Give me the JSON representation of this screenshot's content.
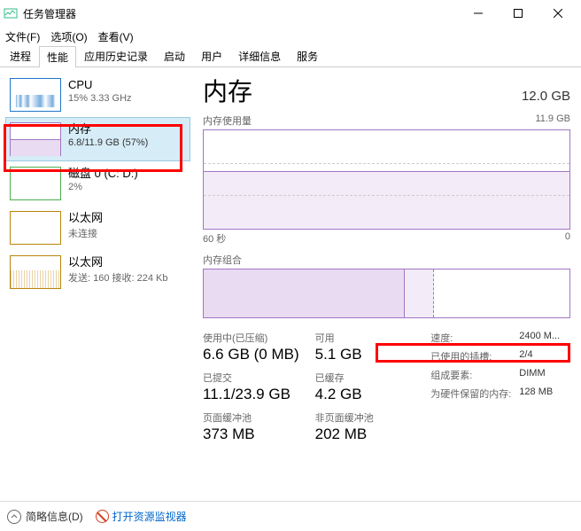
{
  "window": {
    "title": "任务管理器"
  },
  "menu": {
    "file": "文件(F)",
    "options": "选项(O)",
    "view": "查看(V)"
  },
  "tabs": [
    "进程",
    "性能",
    "应用历史记录",
    "启动",
    "用户",
    "详细信息",
    "服务"
  ],
  "sidebar": {
    "cpu": {
      "title": "CPU",
      "sub": "15% 3.33 GHz"
    },
    "mem": {
      "title": "内存",
      "sub": "6.8/11.9 GB (57%)"
    },
    "disk": {
      "title": "磁盘 0 (C: D:)",
      "sub": "2%"
    },
    "eth1": {
      "title": "以太网",
      "sub": "未连接"
    },
    "eth2": {
      "title": "以太网",
      "sub": "发送: 160 接收: 224 Kb"
    }
  },
  "main": {
    "title": "内存",
    "total": "12.0 GB",
    "usage_label": "内存使用量",
    "usage_max": "11.9 GB",
    "timespan": "60 秒",
    "zero": "0",
    "composition_label": "内存组合",
    "inuse_label": "使用中(已压缩)",
    "inuse_val": "6.6 GB (0 MB)",
    "avail_label": "可用",
    "avail_val": "5.1 GB",
    "commit_label": "已提交",
    "commit_val": "11.1/23.9 GB",
    "cached_label": "已缓存",
    "cached_val": "4.2 GB",
    "paged_label": "页面缓冲池",
    "paged_val": "373 MB",
    "nonpaged_label": "非页面缓冲池",
    "nonpaged_val": "202 MB",
    "speed_k": "速度:",
    "speed_v": "2400 M...",
    "slots_k": "已使用的插槽:",
    "slots_v": "2/4",
    "form_k": "组成要素:",
    "form_v": "DIMM",
    "reserved_k": "为硬件保留的内存:",
    "reserved_v": "128 MB"
  },
  "footer": {
    "fewer": "简略信息(D)",
    "resmon": "打开资源监视器"
  }
}
